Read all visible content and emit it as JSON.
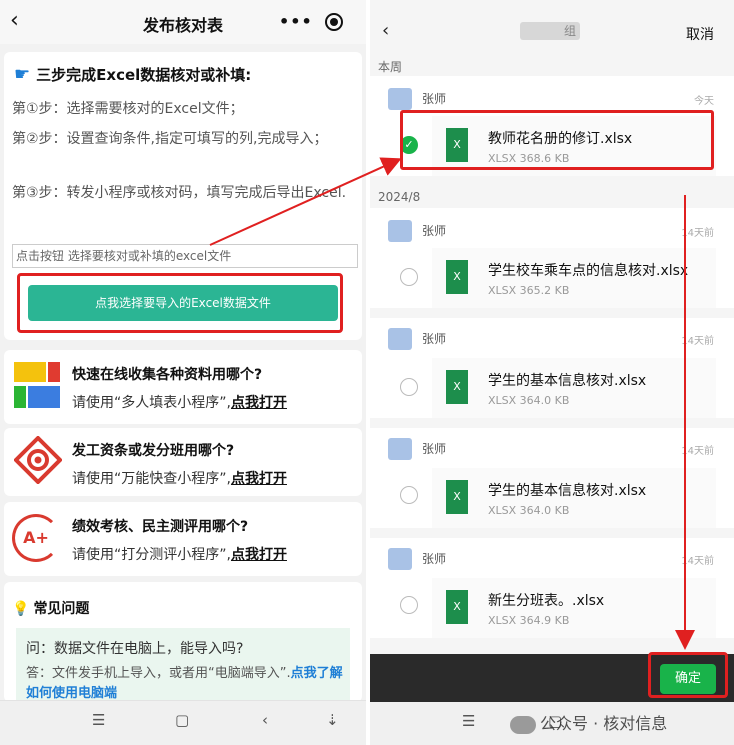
{
  "left": {
    "header": {
      "back_icon": "chevron-left-icon",
      "title": "发布核对表",
      "more": "•••"
    },
    "intro": {
      "heading": "三步完成Excel数据核对或补填:",
      "step1": "第①步：选择需要核对的Excel文件；",
      "step2": "第②步：设置查询条件,指定可填写的列,完成导入；",
      "step3": "第③步：转发小程序或核对码，填写完成后导出Excel.",
      "hint": "点击按钮 选择要核对或补填的excel文件",
      "choose_button": "点我选择要导入的Excel数据文件"
    },
    "cards": [
      {
        "title": "快速在线收集各种资料用哪个?",
        "desc": "请使用“多人填表小程序”,",
        "link": "点我打开"
      },
      {
        "title": "发工资条或发分班用哪个?",
        "desc": "请使用“万能快查小程序”,",
        "link": "点我打开"
      },
      {
        "title": "绩效考核、民主测评用哪个?",
        "desc": "请使用“打分测评小程序”,",
        "link": "点我打开",
        "logo_text": "A+"
      }
    ],
    "faq": {
      "title": "常见问题",
      "question": "问：数据文件在电脑上，能导入吗?",
      "answer_prefix": "答：文件发手机上导入，或者用“电脑端导入”.",
      "answer_link": "点我了解如何使用电脑端"
    },
    "nav": {
      "menu": "☰",
      "home": "▢",
      "back": "‹",
      "down": "⇣"
    }
  },
  "right": {
    "header": {
      "back": "‹",
      "title": "组",
      "cancel": "取消"
    },
    "sections": {
      "recent": "本周",
      "month": "2024/8"
    },
    "sender": "张师",
    "files": [
      {
        "name": "教师花名册的修订.xlsx",
        "size": "XLSX 368.6 KB",
        "time": "今天",
        "checked": true
      },
      {
        "name": "学生校车乘车点的信息核对.xlsx",
        "size": "XLSX 365.2 KB",
        "time": "14天前",
        "checked": false
      },
      {
        "name": "学生的基本信息核对.xlsx",
        "size": "XLSX 364.0 KB",
        "time": "14天前",
        "checked": false
      },
      {
        "name": "学生的基本信息核对.xlsx",
        "size": "XLSX 364.0 KB",
        "time": "14天前",
        "checked": false
      },
      {
        "name": "新生分班表。.xlsx",
        "size": "XLSX 364.9 KB",
        "time": "14天前",
        "checked": false
      }
    ],
    "xlsx_glyph": "X",
    "confirm": "确定",
    "watermark": "公众号 · 核对信息",
    "nav": {
      "menu": "☰",
      "home": "▢"
    }
  },
  "colors": {
    "accent_green": "#2bb594",
    "confirm_green": "#19b34a",
    "highlight_red": "#e02020",
    "xlsx_green": "#1d8e4c"
  }
}
